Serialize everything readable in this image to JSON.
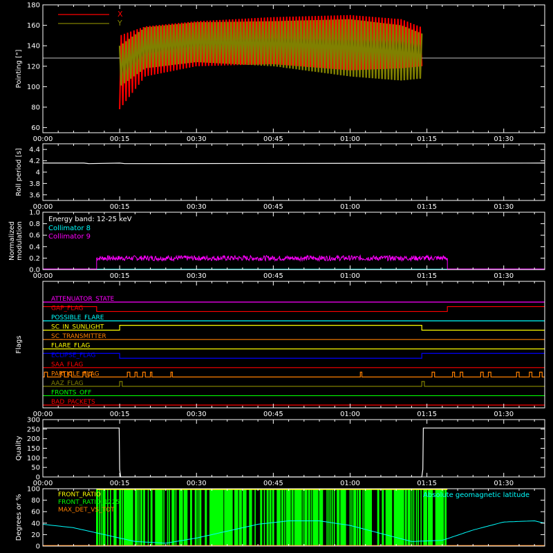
{
  "figure": {
    "background": "#000000",
    "axis_color": "#ffffff"
  },
  "chart_data": [
    {
      "id": "pointing",
      "type": "line",
      "ylabel": "Pointing [\"]",
      "ylim": [
        55,
        180
      ],
      "yticks": [
        60,
        80,
        100,
        120,
        140,
        160,
        180
      ],
      "xlim_min": [
        0,
        98
      ],
      "xticks": [
        "00:00",
        "00:15",
        "00:30",
        "00:45",
        "01:00",
        "01:15",
        "01:30"
      ],
      "xtick_minutes": [
        0,
        15,
        30,
        45,
        60,
        75,
        90
      ],
      "reference_line": 128,
      "legend": [
        {
          "name": "X",
          "color": "#ff0000"
        },
        {
          "name": "Y",
          "color": "#808000"
        }
      ],
      "data_range_min": [
        15,
        74
      ],
      "x_envelope": {
        "min": [
          0,
          15,
          20,
          30,
          45,
          60,
          70,
          74
        ],
        "high": [
          150,
          150,
          159,
          164,
          168,
          170,
          166,
          158
        ],
        "low": [
          90,
          78,
          110,
          120,
          122,
          116,
          118,
          120
        ]
      },
      "y_envelope": {
        "min": [
          0,
          15,
          20,
          30,
          45,
          60,
          70,
          74
        ],
        "high": [
          140,
          140,
          158,
          163,
          164,
          166,
          160,
          152
        ],
        "low": [
          100,
          100,
          118,
          124,
          120,
          110,
          106,
          108
        ]
      }
    },
    {
      "id": "roll",
      "type": "line",
      "ylabel": "Roll period [s]",
      "ylim": [
        3.5,
        4.5
      ],
      "yticks": [
        3.6,
        3.8,
        4.0,
        4.2,
        4.4
      ],
      "xticks": [
        "00:00",
        "00:15",
        "00:30",
        "00:45",
        "01:00",
        "01:15",
        "01:30"
      ],
      "series": [
        {
          "name": "",
          "color": "#ffffff",
          "x": [
            0,
            8,
            9,
            15,
            16,
            98
          ],
          "y": [
            4.16,
            4.16,
            4.15,
            4.16,
            4.15,
            4.16
          ]
        }
      ]
    },
    {
      "id": "modulation",
      "type": "line",
      "ylabel": "Normalized modulation",
      "ylabel_lines": [
        "Normalized",
        "modulation"
      ],
      "ylim": [
        0,
        1
      ],
      "yticks": [
        "0.0",
        "0.2",
        "0.4",
        "0.6",
        "0.8",
        "1.0"
      ],
      "xticks": [
        "00:00",
        "00:15",
        "00:30",
        "00:45",
        "01:00",
        "01:15",
        "01:30"
      ],
      "legend_title": "Energy band: 12-25 keV",
      "legend": [
        {
          "name": "Collimator 8",
          "color": "#00ffff"
        },
        {
          "name": "Collimator 9",
          "color": "#ff00ff"
        }
      ],
      "active_range_min": [
        10.5,
        79
      ],
      "level": 0.2
    },
    {
      "id": "flags",
      "type": "line",
      "ylabel": "Flags",
      "xticks": [
        "00:00",
        "00:15",
        "00:30",
        "00:45",
        "01:00",
        "01:15",
        "01:30"
      ],
      "flags": [
        {
          "name": "ATTENUATOR_STATE",
          "color": "#ff00ff",
          "steps": [
            [
              0,
              0
            ]
          ]
        },
        {
          "name": "GAP_FLAG",
          "color": "#ff0000",
          "steps": [
            [
              0,
              1
            ],
            [
              10.5,
              0
            ],
            [
              79,
              1
            ]
          ]
        },
        {
          "name": "POSSIBLE_FLARE",
          "color": "#00ffff",
          "steps": [
            [
              0,
              0
            ]
          ]
        },
        {
          "name": "SC_IN_SUNLIGHT",
          "color": "#ffff00",
          "steps": [
            [
              0,
              0
            ],
            [
              15,
              1
            ],
            [
              74,
              0
            ]
          ]
        },
        {
          "name": "SC_TRANSMITTER",
          "color": "#ff8000",
          "steps": [
            [
              0,
              0
            ]
          ]
        },
        {
          "name": "FLARE_FLAG",
          "color": "#ffff00",
          "steps": [
            [
              0,
              0
            ]
          ]
        },
        {
          "name": "ECLIPSE_FLAG",
          "color": "#0000ff",
          "steps": [
            [
              0,
              1
            ],
            [
              15,
              0
            ],
            [
              74,
              1
            ]
          ]
        },
        {
          "name": "SAA_FLAG",
          "color": "#ff0000",
          "steps": [
            [
              0,
              0
            ]
          ]
        },
        {
          "name": "PARTICLE_FLAG",
          "color": "#ff8000",
          "pulses": [
            [
              0.3,
              0.9
            ],
            [
              3.5,
              4.2
            ],
            [
              5,
              5.6
            ],
            [
              7.8,
              8.4
            ],
            [
              9,
              9.5
            ],
            [
              16.5,
              17
            ],
            [
              18,
              18.4
            ],
            [
              19.5,
              20
            ],
            [
              21,
              21.3
            ],
            [
              25,
              25.3
            ],
            [
              62,
              62.3
            ],
            [
              76,
              76.5
            ],
            [
              80,
              80.4
            ],
            [
              81.5,
              82
            ],
            [
              85.5,
              86
            ],
            [
              87,
              87.5
            ],
            [
              92.5,
              93
            ],
            [
              95,
              95.5
            ],
            [
              97,
              97.5
            ]
          ]
        },
        {
          "name": "AAZ_FLAG",
          "color": "#808000",
          "pulses": [
            [
              15,
              15.5
            ],
            [
              74,
              74.5
            ]
          ]
        },
        {
          "name": "FRONTS_OFF",
          "color": "#00ff00",
          "steps": [
            [
              0,
              0
            ]
          ]
        },
        {
          "name": "BAD_PACKETS",
          "color": "#ff0000",
          "steps": [
            [
              0,
              0
            ]
          ]
        }
      ]
    },
    {
      "id": "quality",
      "type": "line",
      "ylabel": "Quality",
      "ylim": [
        0,
        300
      ],
      "yticks": [
        0,
        50,
        100,
        150,
        200,
        250,
        300
      ],
      "xticks": [
        "00:00",
        "00:15",
        "00:30",
        "00:45",
        "01:00",
        "01:15",
        "01:30"
      ],
      "series": [
        {
          "name": "",
          "color": "#ffffff",
          "x": [
            0,
            14.9,
            15,
            15.2,
            74,
            74.2,
            74.3,
            98
          ],
          "y": [
            256,
            256,
            40,
            0,
            0,
            40,
            256,
            256
          ]
        }
      ]
    },
    {
      "id": "ratios",
      "type": "line",
      "ylabel": "Degrees or %",
      "ylim": [
        0,
        100
      ],
      "yticks": [
        0,
        20,
        40,
        60,
        80,
        100
      ],
      "legend": [
        {
          "name": "FRONT_RATIO",
          "color": "#ffff00"
        },
        {
          "name": "FRONT_RATIO_1225",
          "color": "#00ff00"
        },
        {
          "name": "MAX_DET_VS_TOT",
          "color": "#ff8000"
        }
      ],
      "right_label": {
        "text": "Absolute geomagnetic latitude",
        "color": "#00ffff"
      },
      "latitude": {
        "x": [
          0,
          6,
          12,
          18,
          24,
          30,
          36,
          42,
          48,
          54,
          60,
          66,
          72,
          78,
          84,
          90,
          96,
          98
        ],
        "y": [
          38,
          32,
          20,
          8,
          5,
          14,
          26,
          38,
          44,
          44,
          36,
          22,
          8,
          10,
          28,
          42,
          44,
          40
        ]
      },
      "active_range_min": [
        10.5,
        79
      ]
    }
  ]
}
